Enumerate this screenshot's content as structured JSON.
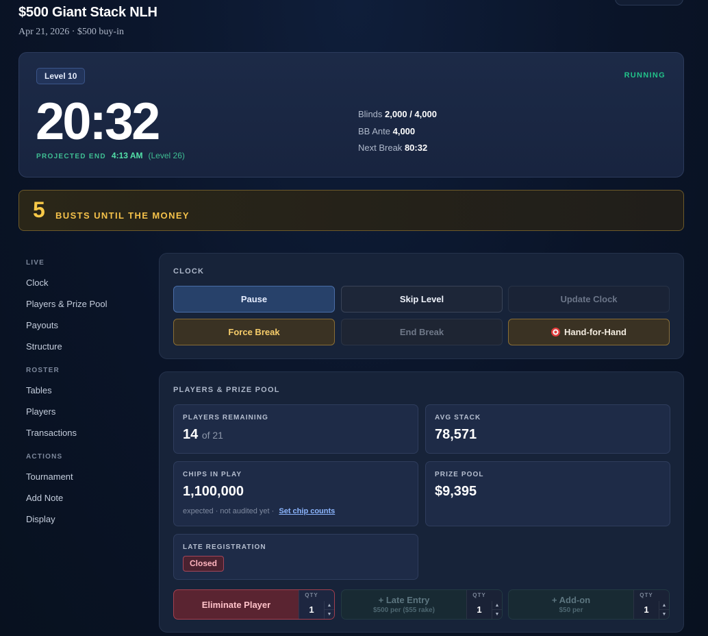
{
  "header": {
    "title": "$500 Giant Stack NLH",
    "subtitle": "Apr 21, 2026 · $500 buy-in"
  },
  "clock": {
    "level": "Level 10",
    "status": "RUNNING",
    "time": "20:32",
    "projected_label": "PROJECTED END",
    "projected_time": "4:13 AM",
    "projected_level": "(Level 26)",
    "blinds_label": "Blinds",
    "blinds_value": "2,000 / 4,000",
    "ante_label": "BB Ante",
    "ante_value": "4,000",
    "next_break_label": "Next Break",
    "next_break_value": "80:32"
  },
  "bubble": {
    "count": "5",
    "label": "BUSTS UNTIL THE MONEY"
  },
  "sidebar": {
    "groups": [
      {
        "title": "LIVE",
        "items": [
          "Clock",
          "Players & Prize Pool",
          "Payouts",
          "Structure"
        ]
      },
      {
        "title": "ROSTER",
        "items": [
          "Tables",
          "Players",
          "Transactions"
        ]
      },
      {
        "title": "ACTIONS",
        "items": [
          "Tournament",
          "Add Note",
          "Display"
        ]
      }
    ]
  },
  "clock_panel": {
    "heading": "CLOCK",
    "pause": "Pause",
    "skip_level": "Skip Level",
    "update_clock": "Update Clock",
    "force_break": "Force Break",
    "end_break": "End Break",
    "hand_for_hand": "Hand-for-Hand"
  },
  "players_panel": {
    "heading": "PLAYERS & PRIZE POOL",
    "players_remaining_label": "PLAYERS REMAINING",
    "players_remaining": "14",
    "players_total": "of 21",
    "avg_stack_label": "AVG STACK",
    "avg_stack": "78,571",
    "chips_label": "CHIPS IN PLAY",
    "chips_value": "1,100,000",
    "chips_note": "expected · not audited yet ·",
    "chips_link": "Set chip counts",
    "prize_pool_label": "PRIZE POOL",
    "prize_pool": "$9,395",
    "late_reg_label": "LATE REGISTRATION",
    "late_reg_status": "Closed"
  },
  "actions": {
    "qty_label": "QTY",
    "eliminate": {
      "label": "Eliminate Player",
      "qty": "1"
    },
    "late_entry": {
      "label": "+ Late Entry",
      "sub": "$500 per ($55 rake)",
      "qty": "1"
    },
    "add_on": {
      "label": "+ Add-on",
      "sub": "$50 per",
      "qty": "1"
    }
  }
}
